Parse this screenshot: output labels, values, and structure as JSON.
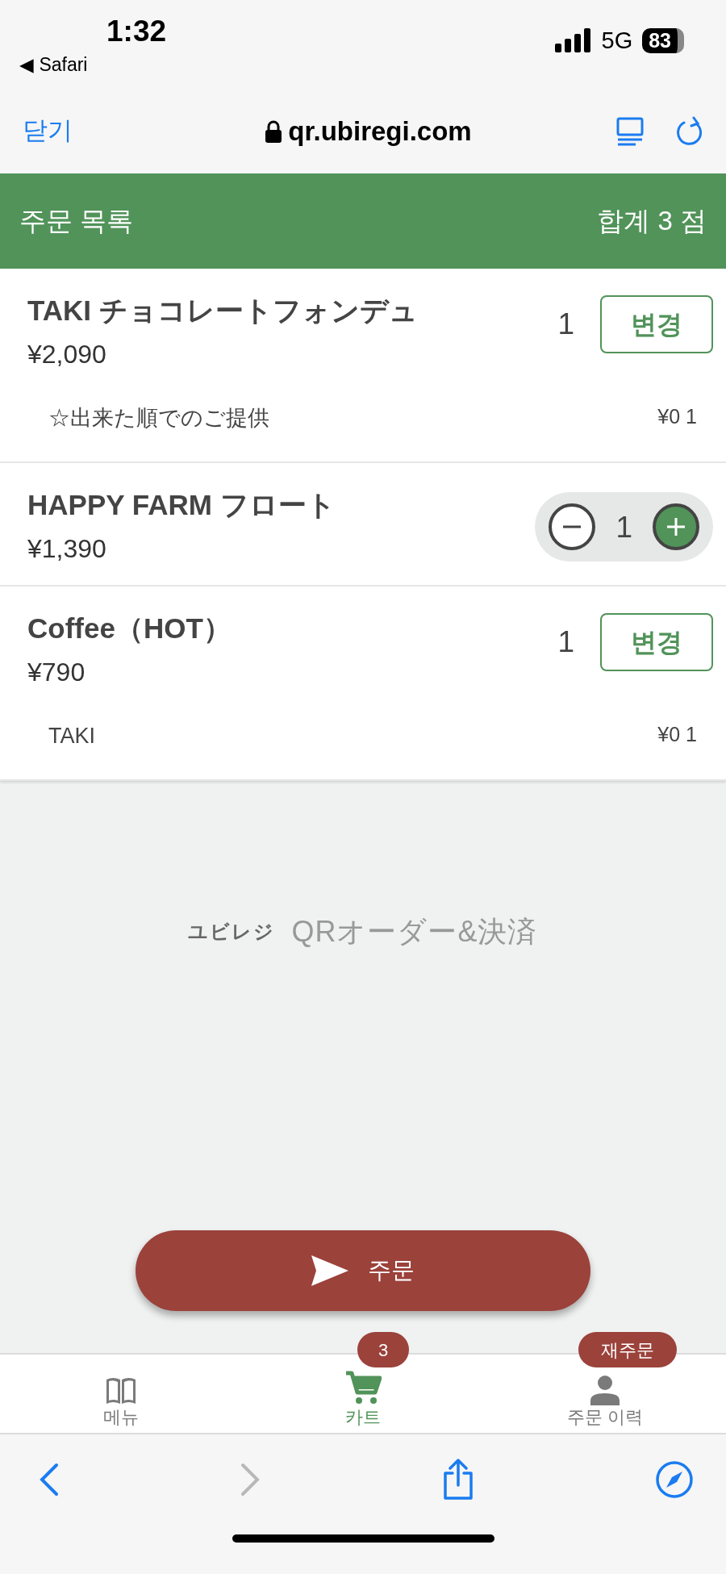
{
  "status_bar": {
    "time": "1:32",
    "back_app": "◀ Safari",
    "network": "5G",
    "battery": "83"
  },
  "browser_bar": {
    "close": "닫기",
    "url": "qr.ubiregi.com"
  },
  "header": {
    "title": "주문 목록",
    "total": "합계 3 점"
  },
  "items": [
    {
      "kind": "change",
      "name": "TAKI チョコレートフォンデュ",
      "price": "¥2,090",
      "quantity": "1",
      "button": "변경",
      "options": [
        {
          "name": "☆出来た順でのご提供",
          "detail": "¥0 1"
        }
      ]
    },
    {
      "kind": "stepper",
      "name": "HAPPY FARM フロート",
      "price": "¥1,390",
      "quantity": "1"
    },
    {
      "kind": "change",
      "name": "Coffee（HOT）",
      "price": "¥790",
      "quantity": "1",
      "button": "변경",
      "options": [
        {
          "name": "TAKI",
          "detail": "¥0 1"
        }
      ]
    }
  ],
  "logo": {
    "brand": "ユビレジ",
    "product": "QRオーダー&決済"
  },
  "order_button": "주문",
  "tab_bar": [
    {
      "kind": "menu",
      "label": "메뉴",
      "selected": false
    },
    {
      "kind": "cart",
      "label": "카트",
      "selected": true,
      "badge": "3"
    },
    {
      "kind": "history",
      "label": "주문 이력",
      "selected": false,
      "badge": "재주문"
    }
  ],
  "toolbar": [
    {
      "kind": "back",
      "disabled": false
    },
    {
      "kind": "forward",
      "disabled": true
    },
    {
      "kind": "share",
      "disabled": false
    },
    {
      "kind": "compass",
      "disabled": false
    }
  ]
}
